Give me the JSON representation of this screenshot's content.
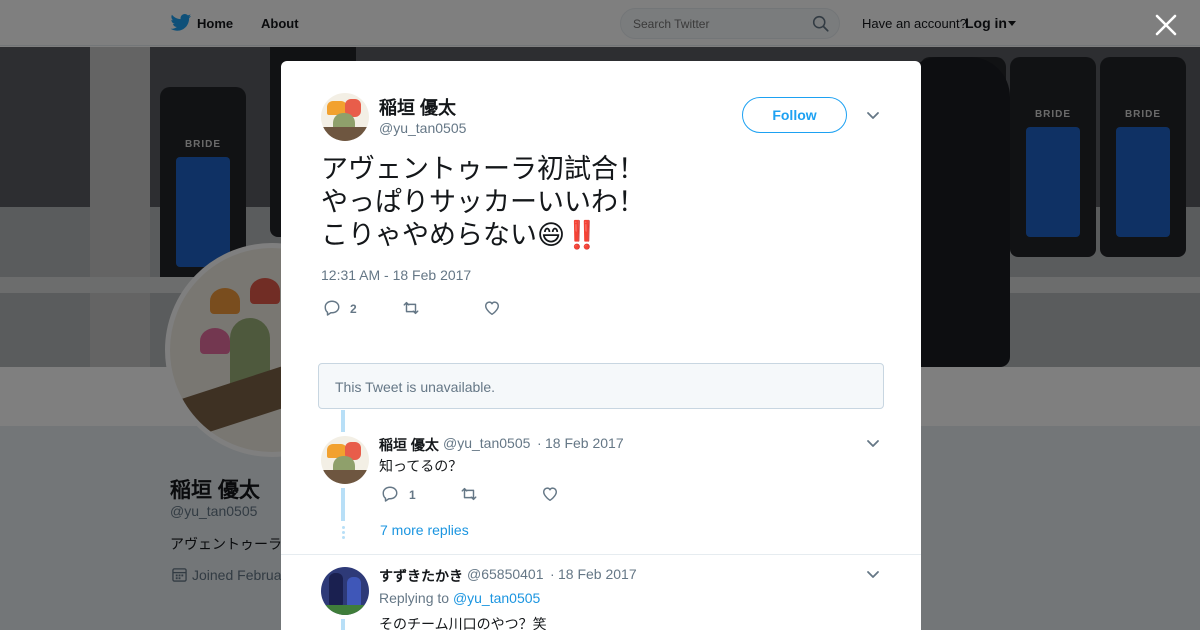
{
  "topbar": {
    "home_label": "Home",
    "about_label": "About",
    "search_placeholder": "Search Twitter",
    "have_account": "Have an account?",
    "login_label": "Log in"
  },
  "cover": {
    "seat_brand": "BRIDE"
  },
  "profile": {
    "name": "稲垣 優太",
    "handle": "@yu_tan0505",
    "bio": "アヴェントゥーラ",
    "joined": "Joined Februa"
  },
  "tweet": {
    "author_name": "稲垣 優太",
    "author_handle": "@yu_tan0505",
    "follow_label": "Follow",
    "text": "アヴェントゥーラ初試合！\nやっぱりサッカーいいわ！\nこりゃやめらない😄‼️",
    "timestamp": "12:31 AM - 18 Feb 2017",
    "reply_count": "2"
  },
  "unavailable_text": "This Tweet is unavailable.",
  "replies": [
    {
      "name": "稲垣 優太",
      "handle": "@yu_tan0505",
      "sep": "·",
      "date": "18 Feb 2017",
      "text": "知ってるの？",
      "reply_count": "1",
      "more_replies": "7 more replies"
    },
    {
      "name": "すずきたかき",
      "handle": "@65850401",
      "sep": "·",
      "date": "18 Feb 2017",
      "replying_to_label": "Replying to",
      "replying_to_handle": "@yu_tan0505",
      "text": "そのチーム川口のやつ？笑"
    }
  ],
  "colors": {
    "accent": "#1da1f2",
    "link": "#1b95e0",
    "muted_text": "#657786",
    "thread_line": "#b8dff7"
  },
  "icons": [
    "twitter-bird-icon",
    "search-icon",
    "close-icon",
    "chevron-down-icon",
    "reply-icon",
    "retweet-icon",
    "like-icon",
    "calendar-icon"
  ]
}
